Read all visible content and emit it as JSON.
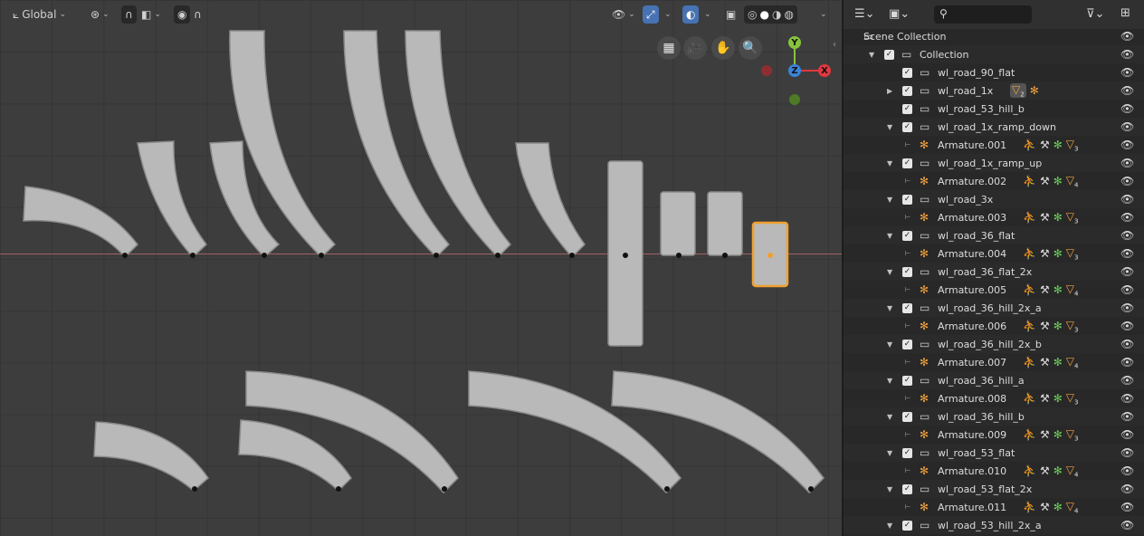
{
  "viewport": {
    "transform_orientation": "Global",
    "nav_icons": [
      "grid-icon",
      "camera-icon",
      "hand-icon",
      "zoom-icon"
    ],
    "gizmo": {
      "x": "X",
      "y": "Y",
      "z": "Z",
      "x_color": "#e2373d",
      "y_color": "#85c43c",
      "z_color": "#3a84db"
    }
  },
  "outliner": {
    "search_placeholder": "",
    "rows": [
      {
        "label": "Scene Collection",
        "type": "scene"
      },
      {
        "label": "Collection",
        "type": "collection"
      },
      {
        "label": "wl_road_90_flat",
        "type": "object"
      },
      {
        "label": "wl_road_1x",
        "type": "object-collapsed",
        "badge": "2"
      },
      {
        "label": "wl_road_53_hill_b",
        "type": "object"
      },
      {
        "label": "wl_road_1x_ramp_down",
        "type": "object-expanded"
      },
      {
        "label": "Armature.001",
        "type": "armature",
        "count": "3"
      },
      {
        "label": "wl_road_1x_ramp_up",
        "type": "object-expanded"
      },
      {
        "label": "Armature.002",
        "type": "armature",
        "count": "4"
      },
      {
        "label": "wl_road_3x",
        "type": "object-expanded"
      },
      {
        "label": "Armature.003",
        "type": "armature",
        "count": "3"
      },
      {
        "label": "wl_road_36_flat",
        "type": "object-expanded"
      },
      {
        "label": "Armature.004",
        "type": "armature",
        "count": "3"
      },
      {
        "label": "wl_road_36_flat_2x",
        "type": "object-expanded"
      },
      {
        "label": "Armature.005",
        "type": "armature",
        "count": "4"
      },
      {
        "label": "wl_road_36_hill_2x_a",
        "type": "object-expanded"
      },
      {
        "label": "Armature.006",
        "type": "armature",
        "count": "3"
      },
      {
        "label": "wl_road_36_hill_2x_b",
        "type": "object-expanded"
      },
      {
        "label": "Armature.007",
        "type": "armature",
        "count": "4"
      },
      {
        "label": "wl_road_36_hill_a",
        "type": "object-expanded"
      },
      {
        "label": "Armature.008",
        "type": "armature",
        "count": "3"
      },
      {
        "label": "wl_road_36_hill_b",
        "type": "object-expanded"
      },
      {
        "label": "Armature.009",
        "type": "armature",
        "count": "3"
      },
      {
        "label": "wl_road_53_flat",
        "type": "object-expanded"
      },
      {
        "label": "Armature.010",
        "type": "armature",
        "count": "4"
      },
      {
        "label": "wl_road_53_flat_2x",
        "type": "object-expanded"
      },
      {
        "label": "Armature.011",
        "type": "armature",
        "count": "4"
      },
      {
        "label": "wl_road_53_hill_2x_a",
        "type": "object-expanded"
      }
    ]
  }
}
